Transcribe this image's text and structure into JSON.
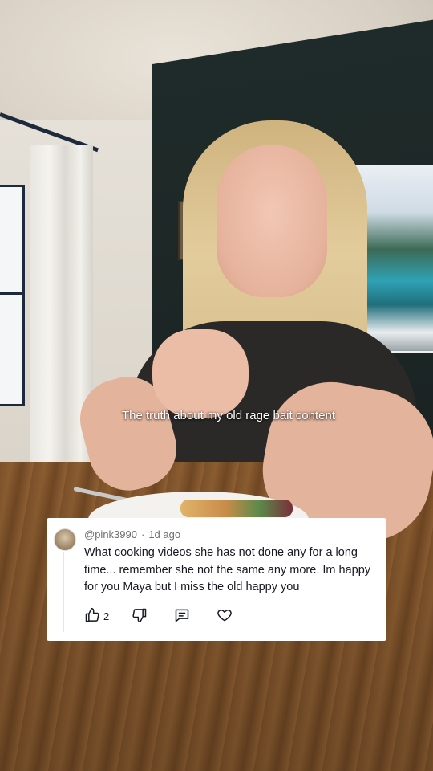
{
  "video": {
    "caption": "The truth about my old rage bait content"
  },
  "comment": {
    "username": "@pink3990",
    "time": "1d ago",
    "text": "What cooking videos she has not done any for a long time...  remember she not the same any more.   Im happy for you Maya but I miss the old happy you",
    "like_count": "2",
    "icons": {
      "like": "thumbs-up-icon",
      "dislike": "thumbs-down-icon",
      "reply": "reply-icon",
      "favorite": "heart-icon"
    }
  }
}
